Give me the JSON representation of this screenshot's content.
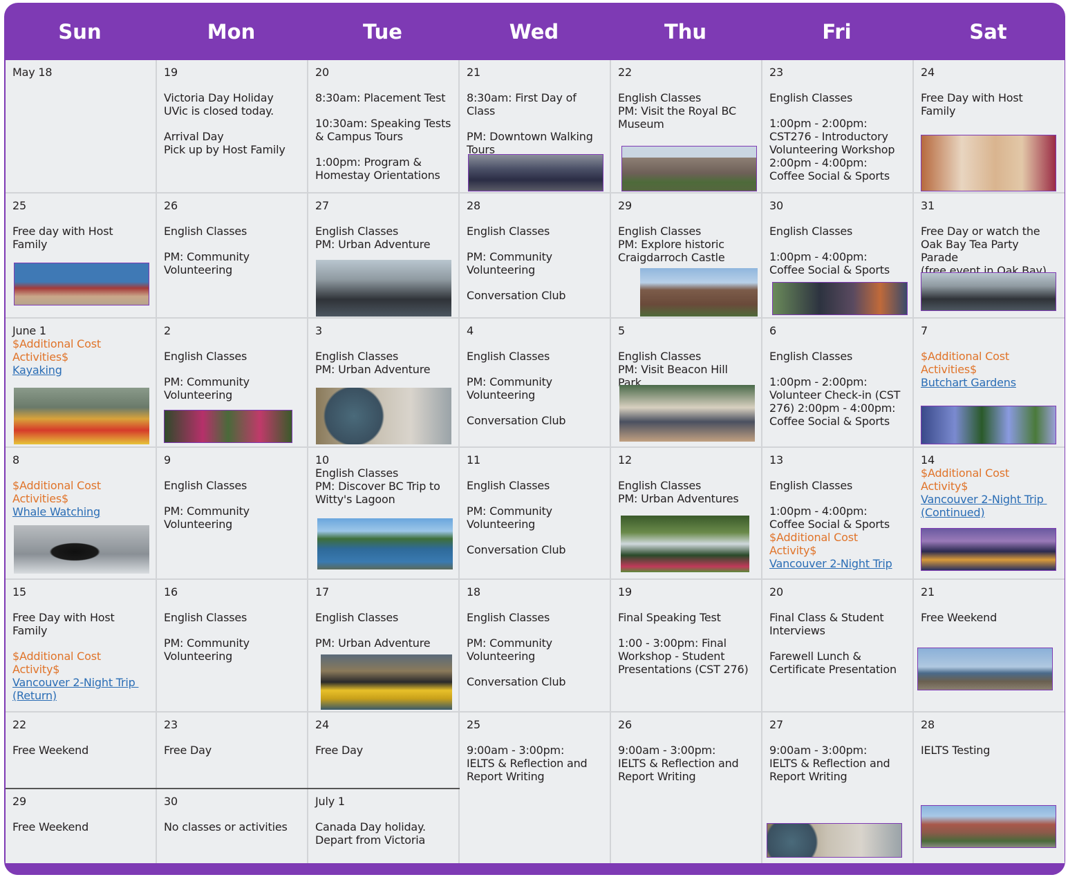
{
  "header": {
    "days": [
      "Sun",
      "Mon",
      "Tue",
      "Wed",
      "Thu",
      "Fri",
      "Sat"
    ]
  },
  "colors": {
    "header_purple": "#7e3ab4",
    "cell_bg": "#eceef0",
    "additional_cost_orange": "#e0742a",
    "link_blue": "#2a6db5"
  },
  "cells": {
    "r1": {
      "sun": {
        "date": "May 18"
      },
      "mon": {
        "date": "19",
        "l1": "Victoria Day Holiday",
        "l2": "UVic is closed today.",
        "l3": "Arrival Day",
        "l4": "Pick up by Host Family"
      },
      "tue": {
        "date": "20",
        "l1": "8:30am: Placement Test",
        "l2": "10:30am: Speaking Tests",
        "l3": "& Campus Tours",
        "l4": "1:00pm: Program &",
        "l5": "Homestay Orientations"
      },
      "wed": {
        "date": "21",
        "l1": "8:30am: First Day of Class",
        "l2": "PM: Downtown Walking",
        "l3": "Tours",
        "photo": "walking-tour-photo"
      },
      "thu": {
        "date": "22",
        "l1": "English Classes",
        "l2": "PM: Visit the Royal BC",
        "l3": "Museum",
        "photo": "royal-bc-museum-photo"
      },
      "fri": {
        "date": "23",
        "l1": "English Classes",
        "l2": "1:00pm - 2:00pm:",
        "l3": "CST276 - Introductory",
        "l4": "Volunteering Workshop",
        "l5": "2:00pm - 4:00pm:",
        "l6": "Coffee Social & Sports"
      },
      "sat": {
        "date": "24",
        "l1": "Free Day with Host",
        "l2": "Family",
        "photo": "host-family-photo"
      }
    },
    "r2": {
      "sun": {
        "date": "25",
        "l1": "Free day with Host Family",
        "photo": "beach-photo"
      },
      "mon": {
        "date": "26",
        "l1": "English Classes",
        "l2": "PM: Community",
        "l3": "Volunteering"
      },
      "tue": {
        "date": "27",
        "l1": "English Classes",
        "l2": "PM: Urban Adventure",
        "photo": "urban-adventure-photo"
      },
      "wed": {
        "date": "28",
        "l1": "English Classes",
        "l2": "PM: Community",
        "l3": "Volunteering",
        "l4": "Conversation Club"
      },
      "thu": {
        "date": "29",
        "l1": "English Classes",
        "l2": "PM: Explore historic",
        "l3": "Craigdarroch Castle",
        "photo": "craigdarroch-castle-photo"
      },
      "fri": {
        "date": "30",
        "l1": "English Classes",
        "l2": "1:00pm - 4:00pm:",
        "l3": "Coffee Social & Sports",
        "photo": "coffee-social-photo"
      },
      "sat": {
        "date": "31",
        "l1": "Free Day or watch the",
        "l2": "Oak Bay Tea Party Parade",
        "l3": "(free event in Oak Bay)",
        "photo": "oak-bay-photo"
      }
    },
    "r3": {
      "sun": {
        "date": "June 1",
        "o1": "$Additional Cost",
        "o2": "Activities$",
        "link": "Kayaking",
        "photo": "kayaking-photo"
      },
      "mon": {
        "date": "2",
        "l1": "English Classes",
        "l2": "PM: Community",
        "l3": "Volunteering",
        "photo": "garden-photo"
      },
      "tue": {
        "date": "3",
        "l1": "English Classes",
        "l2": "PM: Urban Adventure",
        "photo": "globe-classroom-photo"
      },
      "wed": {
        "date": "4",
        "l1": "English Classes",
        "l2": "PM: Community",
        "l3": "Volunteering",
        "l4": "Conversation Club"
      },
      "thu": {
        "date": "5",
        "l1": "English Classes",
        "l2": "PM: Visit Beacon Hill Park",
        "photo": "classroom-students-photo"
      },
      "fri": {
        "date": "6",
        "l1": "English Classes",
        "l2": "1:00pm - 2:00pm:",
        "l3": "Volunteer Check-in (CST",
        "l4": "276) 2:00pm - 4:00pm:",
        "l5": "Coffee Social & Sports"
      },
      "sat": {
        "date": "7",
        "o1": "$Additional Cost",
        "o2": "Activities$",
        "link": "Butchart Gardens",
        "photo": "butchart-gardens-photo"
      }
    },
    "r4": {
      "sun": {
        "date": "8",
        "o1": "$Additional Cost",
        "o2": "Activities$",
        "link": "Whale Watching",
        "photo": "orca-photo"
      },
      "mon": {
        "date": "9",
        "l1": "English Classes",
        "l2": "PM: Community",
        "l3": "Volunteering"
      },
      "tue": {
        "date": "10",
        "l1": "English Classes",
        "l2": "PM: Discover BC Trip to",
        "l3": "Witty's Lagoon",
        "photo": "wittys-lagoon-photo"
      },
      "wed": {
        "date": "11",
        "l1": "English Classes",
        "l2": "PM: Community",
        "l3": "Volunteering",
        "l4": "Conversation Club"
      },
      "thu": {
        "date": "12",
        "l1": "English Classes",
        "l2": "PM: Urban Adventures",
        "photo": "park-pond-photo"
      },
      "fri": {
        "date": "13",
        "l1": "English Classes",
        "l2": "1:00pm - 4:00pm:",
        "l3": "Coffee Social & Sports",
        "o1": "$Additional Cost",
        "o2": "Activity$",
        "link": "Vancouver 2-Night Trip"
      },
      "sat": {
        "date": "14",
        "o1": "$Additional Cost",
        "o2": "Activity$",
        "link1": "Vancouver 2-Night Trip ",
        "link2": "(Continued)",
        "photo": "vancouver-night-photo"
      }
    },
    "r5": {
      "sun": {
        "date": "15",
        "l1": "Free Day with Host",
        "l2": "Family",
        "o1": "$Additional Cost",
        "o2": "Activity$",
        "link1": "Vancouver 2-Night Trip ",
        "link2": "(Return)"
      },
      "mon": {
        "date": "16",
        "l1": "English Classes",
        "l2": "PM: Community",
        "l3": "Volunteering"
      },
      "tue": {
        "date": "17",
        "l1": "English Classes",
        "l2": "PM: Urban Adventure",
        "photo": "water-taxi-photo"
      },
      "wed": {
        "date": "18",
        "l1": "English Classes",
        "l2": "PM: Community",
        "l3": "Volunteering",
        "l4": "Conversation Club"
      },
      "thu": {
        "date": "19",
        "l1": "Final Speaking Test",
        "l2": "1:00 - 3:00pm: Final",
        "l3": "Workshop - Student",
        "l4": "Presentations (CST 276)"
      },
      "fri": {
        "date": "20",
        "l1": "Final Class & Student",
        "l2": "Interviews",
        "l3": "Farewell Lunch &",
        "l4": "Certificate Presentation"
      },
      "sat": {
        "date": "21",
        "l1": "Free Weekend",
        "photo": "lighthouse-photo"
      }
    },
    "r6": {
      "sun": {
        "date": "22",
        "l1": "Free Weekend"
      },
      "mon": {
        "date": "23",
        "l1": "Free Day"
      },
      "tue": {
        "date": "24",
        "l1": "Free Day"
      },
      "wed": {
        "date": "25",
        "l1": "9:00am - 3:00pm:",
        "l2": "IELTS & Reflection and",
        "l3": "Report Writing"
      },
      "thu": {
        "date": "26",
        "l1": "9:00am - 3:00pm:",
        "l2": "IELTS & Reflection and",
        "l3": "Report Writing"
      },
      "fri": {
        "date": "27",
        "l1": "9:00am - 3:00pm:",
        "l2": "IELTS & Reflection and",
        "l3": "Report Writing",
        "photo": "study-room-photo"
      },
      "sat": {
        "date": "28",
        "l1": "IELTS Testing",
        "photo": "campus-building-photo"
      }
    },
    "r7": {
      "sun": {
        "date": "29",
        "l1": "Free Weekend"
      },
      "mon": {
        "date": "30",
        "l1": "No classes or activities"
      },
      "tue": {
        "date": "July 1",
        "l1": "Canada Day holiday.",
        "l2": "Depart from Victoria"
      }
    }
  }
}
